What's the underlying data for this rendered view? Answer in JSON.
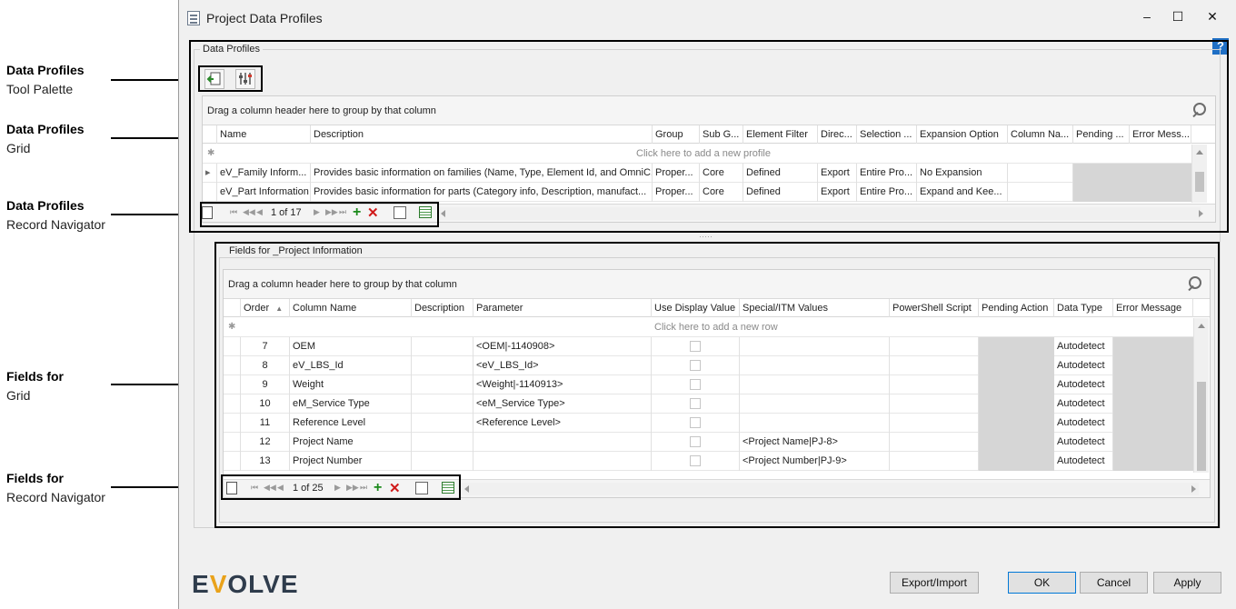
{
  "annotations": [
    {
      "bold": "Data Profiles",
      "normal": "Tool Palette"
    },
    {
      "bold": "Data Profiles",
      "normal": "Grid"
    },
    {
      "bold": "Data Profiles",
      "normal": "Record Navigator"
    },
    {
      "bold": "Fields for",
      "normal": "Grid"
    },
    {
      "bold": "Fields for",
      "normal": "Record Navigator"
    }
  ],
  "window": {
    "title": "Project Data Profiles",
    "minimize": "–",
    "maximize": "☐",
    "close": "✕",
    "help": "?"
  },
  "profiles": {
    "group_title": "Data Profiles",
    "group_by_hint": "Drag a column header here to group by that column",
    "add_row_hint": "Click here to add a new profile",
    "columns": [
      "Name",
      "Description",
      "Group",
      "Sub G...",
      "Element Filter",
      "Direc...",
      "Selection ...",
      "Expansion Option",
      "Column Na...",
      "Pending ...",
      "Error Mess..."
    ],
    "rows": [
      {
        "name": "eV_Family Inform...",
        "description": "Provides basic information on families (Name, Type, Element Id, and OmniC...",
        "group": "Proper...",
        "sub_group": "Core",
        "element_filter": "Defined",
        "direction": "Export",
        "selection": "Entire Pro...",
        "expansion": "No Expansion",
        "column_name": "",
        "pending": "",
        "error": ""
      },
      {
        "name": "eV_Part Information",
        "description": "Provides basic information for parts (Category info, Description, manufact...",
        "group": "Proper...",
        "sub_group": "Core",
        "element_filter": "Defined",
        "direction": "Export",
        "selection": "Entire Pro...",
        "expansion": "Expand and Kee...",
        "column_name": "",
        "pending": "",
        "error": ""
      }
    ],
    "navigator": {
      "record": "1 of 17"
    }
  },
  "fields": {
    "group_title": "Fields for _Project Information",
    "group_by_hint": "Drag a column header here to group by that column",
    "add_row_hint": "Click here to add a new row",
    "columns": [
      "Order",
      "Column Name",
      "Description",
      "Parameter",
      "Use Display Value",
      "Special/ITM Values",
      "PowerShell Script",
      "Pending Action",
      "Data Type",
      "Error Message"
    ],
    "sort_indicator": "▲",
    "rows": [
      {
        "order": "7",
        "column_name": "OEM",
        "description": "",
        "parameter": "<OEM|-1140908>",
        "special": "",
        "data_type": "Autodetect"
      },
      {
        "order": "8",
        "column_name": "eV_LBS_Id",
        "description": "",
        "parameter": "<eV_LBS_Id>",
        "special": "",
        "data_type": "Autodetect"
      },
      {
        "order": "9",
        "column_name": "Weight",
        "description": "",
        "parameter": "<Weight|-1140913>",
        "special": "",
        "data_type": "Autodetect"
      },
      {
        "order": "10",
        "column_name": "eM_Service Type",
        "description": "",
        "parameter": "<eM_Service Type>",
        "special": "",
        "data_type": "Autodetect"
      },
      {
        "order": "11",
        "column_name": "Reference Level",
        "description": "",
        "parameter": "<Reference Level>",
        "special": "",
        "data_type": "Autodetect"
      },
      {
        "order": "12",
        "column_name": "Project Name",
        "description": "",
        "parameter": "",
        "special": "<Project Name|PJ-8>",
        "data_type": "Autodetect"
      },
      {
        "order": "13",
        "column_name": "Project Number",
        "description": "",
        "parameter": "",
        "special": "<Project Number|PJ-9>",
        "data_type": "Autodetect"
      }
    ],
    "navigator": {
      "record": "1 of 25"
    }
  },
  "footer": {
    "logo_e": "E",
    "logo_v": "V",
    "logo_rest": "OLVE",
    "export_import": "Export/Import",
    "ok": "OK",
    "cancel": "Cancel",
    "apply": "Apply"
  }
}
